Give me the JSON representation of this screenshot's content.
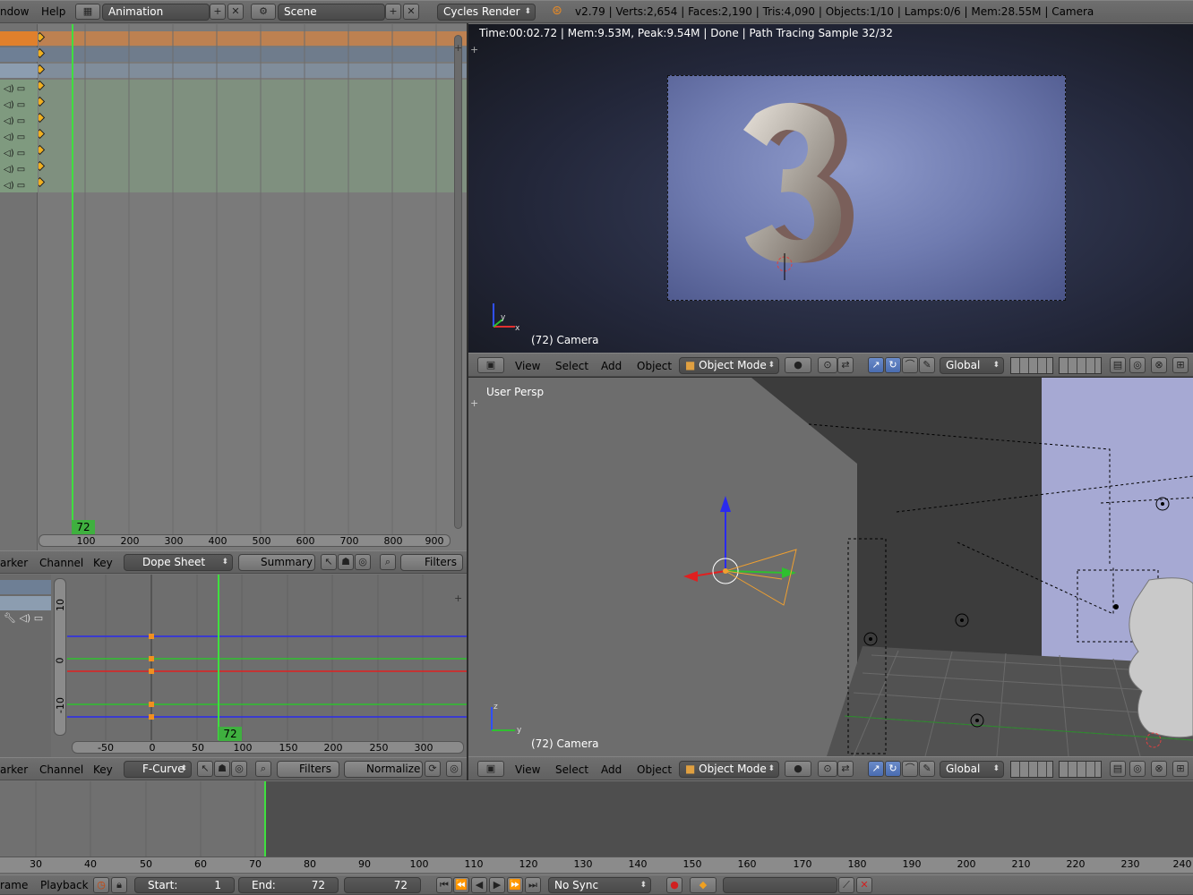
{
  "top": {
    "menu_window": "ndow",
    "menu_help": "Help",
    "layout_name": "Animation",
    "scene_name": "Scene",
    "engine": "Cycles Render",
    "stats": "v2.79 | Verts:2,654 | Faces:2,190 | Tris:4,090 | Objects:1/10 | Lamps:0/6 | Mem:28.55M | Camera"
  },
  "render_view": {
    "status": "Time:00:02.72 | Mem:9.53M, Peak:9.54M | Done | Path Tracing Sample 32/32",
    "object_label": "(72) Camera",
    "header": {
      "view": "View",
      "select": "Select",
      "add": "Add",
      "object": "Object",
      "mode": "Object Mode",
      "orientation": "Global"
    }
  },
  "persp_view": {
    "title": "User Persp",
    "object_label": "(72) Camera",
    "header": {
      "view": "View",
      "select": "Select",
      "add": "Add",
      "object": "Object",
      "mode": "Object Mode",
      "orientation": "Global"
    }
  },
  "dopesheet": {
    "frame_badge": "72",
    "ruler": [
      "100",
      "200",
      "300",
      "400",
      "500",
      "600",
      "700",
      "800",
      "900"
    ],
    "header": {
      "marker": "arker",
      "channel": "Channel",
      "key": "Key",
      "mode": "Dope Sheet",
      "summary": "Summary",
      "filters": "Filters"
    }
  },
  "graph": {
    "frame_badge": "72",
    "ruler": [
      "-50",
      "0",
      "50",
      "100",
      "150",
      "200",
      "250",
      "300"
    ],
    "yticks": [
      "10",
      "0",
      "-10"
    ],
    "header": {
      "marker": "arker",
      "channel": "Channel",
      "key": "Key",
      "mode": "F-Curve",
      "filters": "Filters",
      "normalize": "Normalize"
    }
  },
  "timeline": {
    "ruler": [
      "30",
      "40",
      "50",
      "60",
      "70",
      "80",
      "90",
      "100",
      "110",
      "120",
      "130",
      "140",
      "150",
      "160",
      "170",
      "180",
      "190",
      "200",
      "210",
      "220",
      "230",
      "240"
    ],
    "header": {
      "marker": "rame",
      "playback": "Playback",
      "start_label": "Start:",
      "start_value": "1",
      "end_label": "End:",
      "end_value": "72",
      "current": "72",
      "sync": "No Sync"
    }
  },
  "colors": {
    "accent_blue": "#5680c2",
    "frame_green": "#3fbf3f",
    "key_orange": "#f0a020"
  }
}
